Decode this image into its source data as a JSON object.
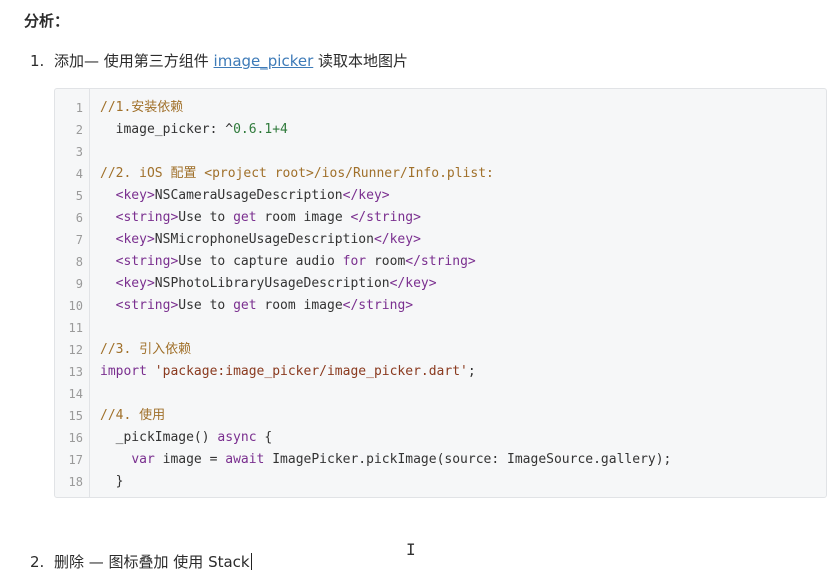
{
  "heading": "分析：",
  "item1": {
    "num": "1.",
    "prefix": "添加— 使用第三方组件 ",
    "link": "image_picker",
    "suffix": " 读取本地图片"
  },
  "code": {
    "lines": [
      {
        "n": "1",
        "t": "//1.安装依赖"
      },
      {
        "n": "2",
        "t": "  image_picker: ^0.6.1+4"
      },
      {
        "n": "3",
        "t": ""
      },
      {
        "n": "4",
        "t": "//2. iOS 配置 <project root>/ios/Runner/Info.plist:"
      },
      {
        "n": "5",
        "t": "  <key>NSCameraUsageDescription</key>"
      },
      {
        "n": "6",
        "t": "  <string>Use to get room image </string>"
      },
      {
        "n": "7",
        "t": "  <key>NSMicrophoneUsageDescription</key>"
      },
      {
        "n": "8",
        "t": "  <string>Use to capture audio for room</string>"
      },
      {
        "n": "9",
        "t": "  <key>NSPhotoLibraryUsageDescription</key>"
      },
      {
        "n": "10",
        "t": "  <string>Use to get room image</string>"
      },
      {
        "n": "11",
        "t": ""
      },
      {
        "n": "12",
        "t": "//3. 引入依赖"
      },
      {
        "n": "13",
        "t": "import 'package:image_picker/image_picker.dart';"
      },
      {
        "n": "14",
        "t": ""
      },
      {
        "n": "15",
        "t": "//4. 使用"
      },
      {
        "n": "16",
        "t": "  _pickImage() async {"
      },
      {
        "n": "17",
        "t": "    var image = await ImagePicker.pickImage(source: ImageSource.gallery);"
      },
      {
        "n": "18",
        "t": "  }"
      }
    ]
  },
  "item2": {
    "num": "2.",
    "text": "删除 — 图标叠加 使用 Stack"
  },
  "cursor_glyph": "I"
}
